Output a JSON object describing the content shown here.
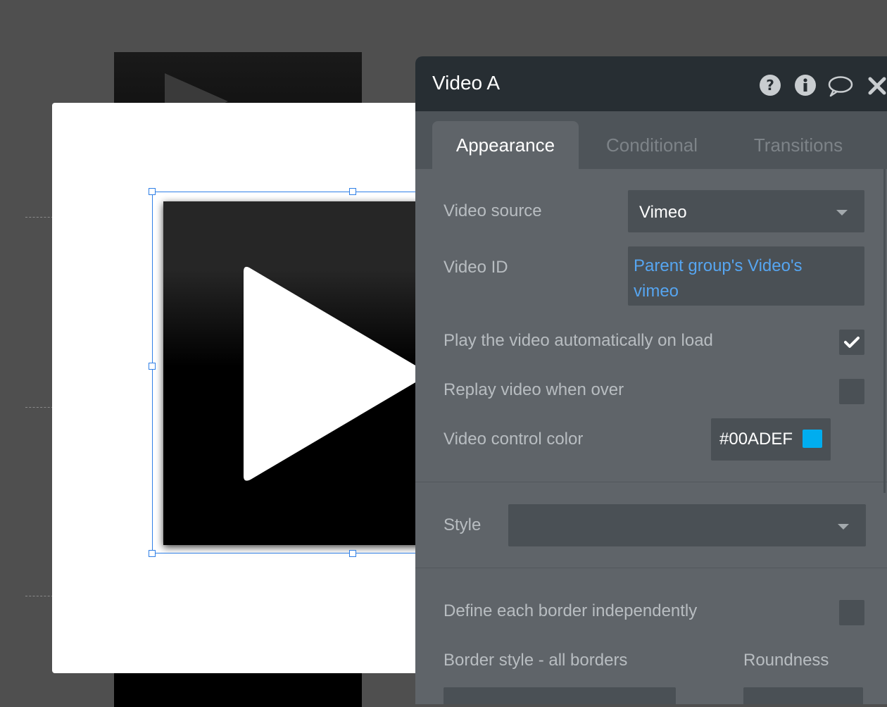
{
  "panel": {
    "title": "Video A",
    "header_icons": [
      "help-icon",
      "info-icon",
      "comment-icon",
      "close-icon"
    ],
    "tabs": [
      {
        "label": "Appearance",
        "active": true
      },
      {
        "label": "Conditional",
        "active": false
      },
      {
        "label": "Transitions",
        "active": false
      }
    ]
  },
  "appearance": {
    "video_source": {
      "label": "Video source",
      "value": "Vimeo"
    },
    "video_id": {
      "label": "Video ID",
      "value": "Parent group's Video's vimeo"
    },
    "autoplay": {
      "label": "Play the video automatically on load",
      "checked": true
    },
    "replay": {
      "label": "Replay video when over",
      "checked": false
    },
    "control_color": {
      "label": "Video control color",
      "value": "#00ADEF"
    },
    "style": {
      "label": "Style",
      "value": ""
    },
    "border_independent": {
      "label": "Define each border independently",
      "checked": false
    },
    "border_style": {
      "label": "Border style - all borders"
    },
    "roundness": {
      "label": "Roundness"
    }
  },
  "colors": {
    "canvas_bg": "#4f4f4f",
    "header_bg": "#272e33",
    "panel_bg": "#5f6469",
    "link": "#56a5f0",
    "selection": "#2f7fe6",
    "control_color": "#00ADEF"
  }
}
